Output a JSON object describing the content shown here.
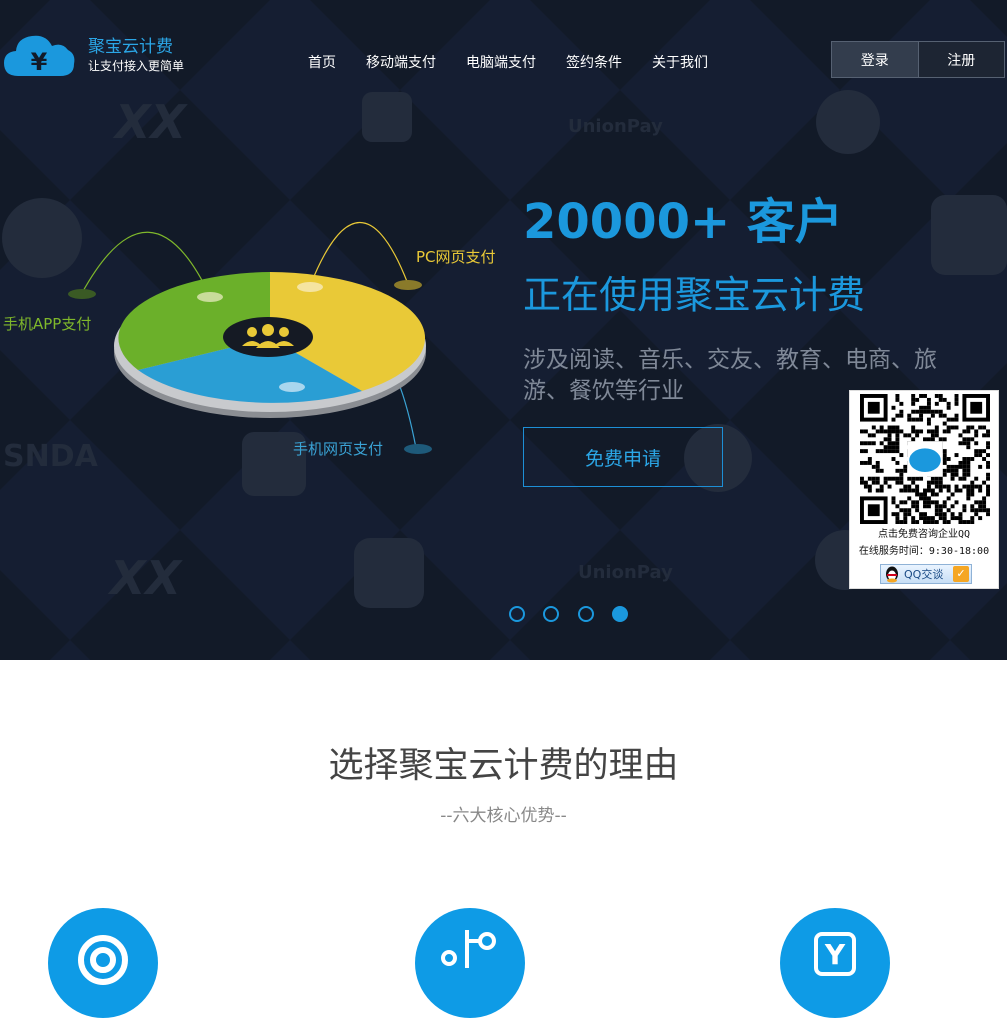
{
  "header": {
    "brand_name": "聚宝云计费",
    "brand_slogan": "让支付接入更简单",
    "nav": [
      "首页",
      "移动端支付",
      "电脑端支付",
      "签约条件",
      "关于我们"
    ],
    "login": "登录",
    "register": "注册"
  },
  "hero": {
    "headline": "20000+ 客户",
    "subheadline": "正在使用聚宝云计费",
    "description": "涉及阅读、音乐、交友、教育、电商、旅游、餐饮等行业",
    "cta": "免费申请",
    "pie_labels": {
      "pc": "PC网页支付",
      "app": "手机APP支付",
      "mobile_web": "手机网页支付"
    },
    "slides": 4,
    "active_slide": 4
  },
  "qq_widget": {
    "caption": "点击免费咨询企业QQ",
    "hours": "在线服务时间：9:30-18:00",
    "button": "QQ交谈"
  },
  "reasons": {
    "title": "选择聚宝云计费的理由",
    "subtitle": "--六大核心优势--"
  },
  "colors": {
    "accent": "#1b98dd",
    "hero_bg": "#121a28",
    "pie_green": "#6bb02a",
    "pie_yellow": "#e9c937",
    "pie_blue": "#2a9ed4"
  }
}
